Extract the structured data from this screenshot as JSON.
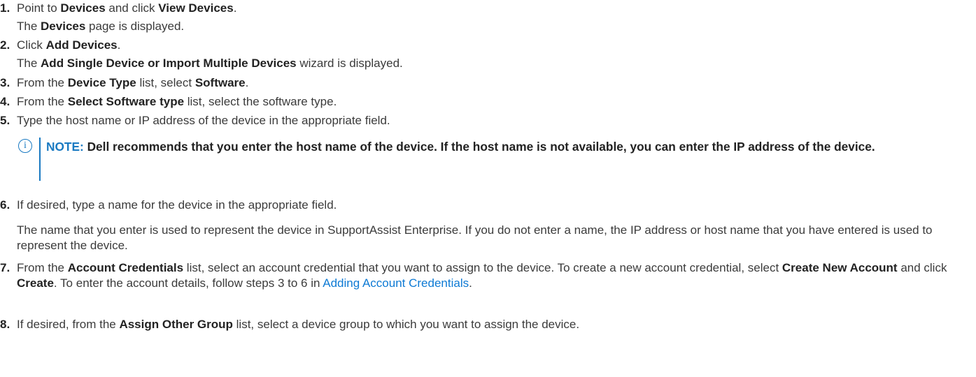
{
  "steps": [
    {
      "number": "1.",
      "lines": [
        {
          "pre": "Point to ",
          "b1": "Devices",
          "mid": " and click ",
          "b2": "View Devices",
          "post": "."
        },
        {
          "pre": "The ",
          "b1": "Devices",
          "post": " page is displayed."
        }
      ]
    },
    {
      "number": "2.",
      "lines": [
        {
          "pre": "Click ",
          "b1": "Add Devices",
          "post": "."
        },
        {
          "pre": "The ",
          "b1": "Add Single Device or Import Multiple Devices",
          "post": " wizard is displayed."
        }
      ]
    },
    {
      "number": "3.",
      "lines": [
        {
          "pre": "From the ",
          "b1": "Device Type",
          "mid": " list, select ",
          "b2": "Software",
          "post": "."
        }
      ]
    },
    {
      "number": "4.",
      "lines": [
        {
          "pre": "From the ",
          "b1": "Select Software type",
          "post": " list, select the software type."
        }
      ]
    },
    {
      "number": "5.",
      "lines": [
        {
          "pre": "Type the host name or IP address of the device in the appropriate field."
        }
      ]
    },
    {
      "number": "6.",
      "lines": [
        {
          "pre": "If desired, type a name for the device in the appropriate field."
        }
      ],
      "paragraph": "The name that you enter is used to represent the device in SupportAssist Enterprise. If you do not enter a name, the IP address or host name that you have entered is used to represent the device."
    },
    {
      "number": "7.",
      "p1": "From the ",
      "b1": "Account Credentials",
      "p2": " list, select an account credential that you want to assign to the device. To create a new account credential, select ",
      "b2": "Create New Account",
      "p3": " and click ",
      "b3": "Create",
      "p4": ". To enter the account details, follow steps 3 to 6 in ",
      "link": "Adding Account Credentials",
      "p5": "."
    },
    {
      "number": "8.",
      "lines": [
        {
          "pre": "If desired, from the ",
          "b1": "Assign Other Group",
          "post": " list, select a device group to which you want to assign the device."
        }
      ]
    }
  ],
  "note": {
    "icon": "info-circle-icon",
    "icon_glyph": "i",
    "label": "NOTE:",
    "text": " Dell recommends that you enter the host name of the device. If the host name is not available, you can enter the IP address of the device."
  },
  "colors": {
    "link": "#0e7ad4",
    "note_accent": "#1a7ac2",
    "text": "#3b3b3b"
  }
}
